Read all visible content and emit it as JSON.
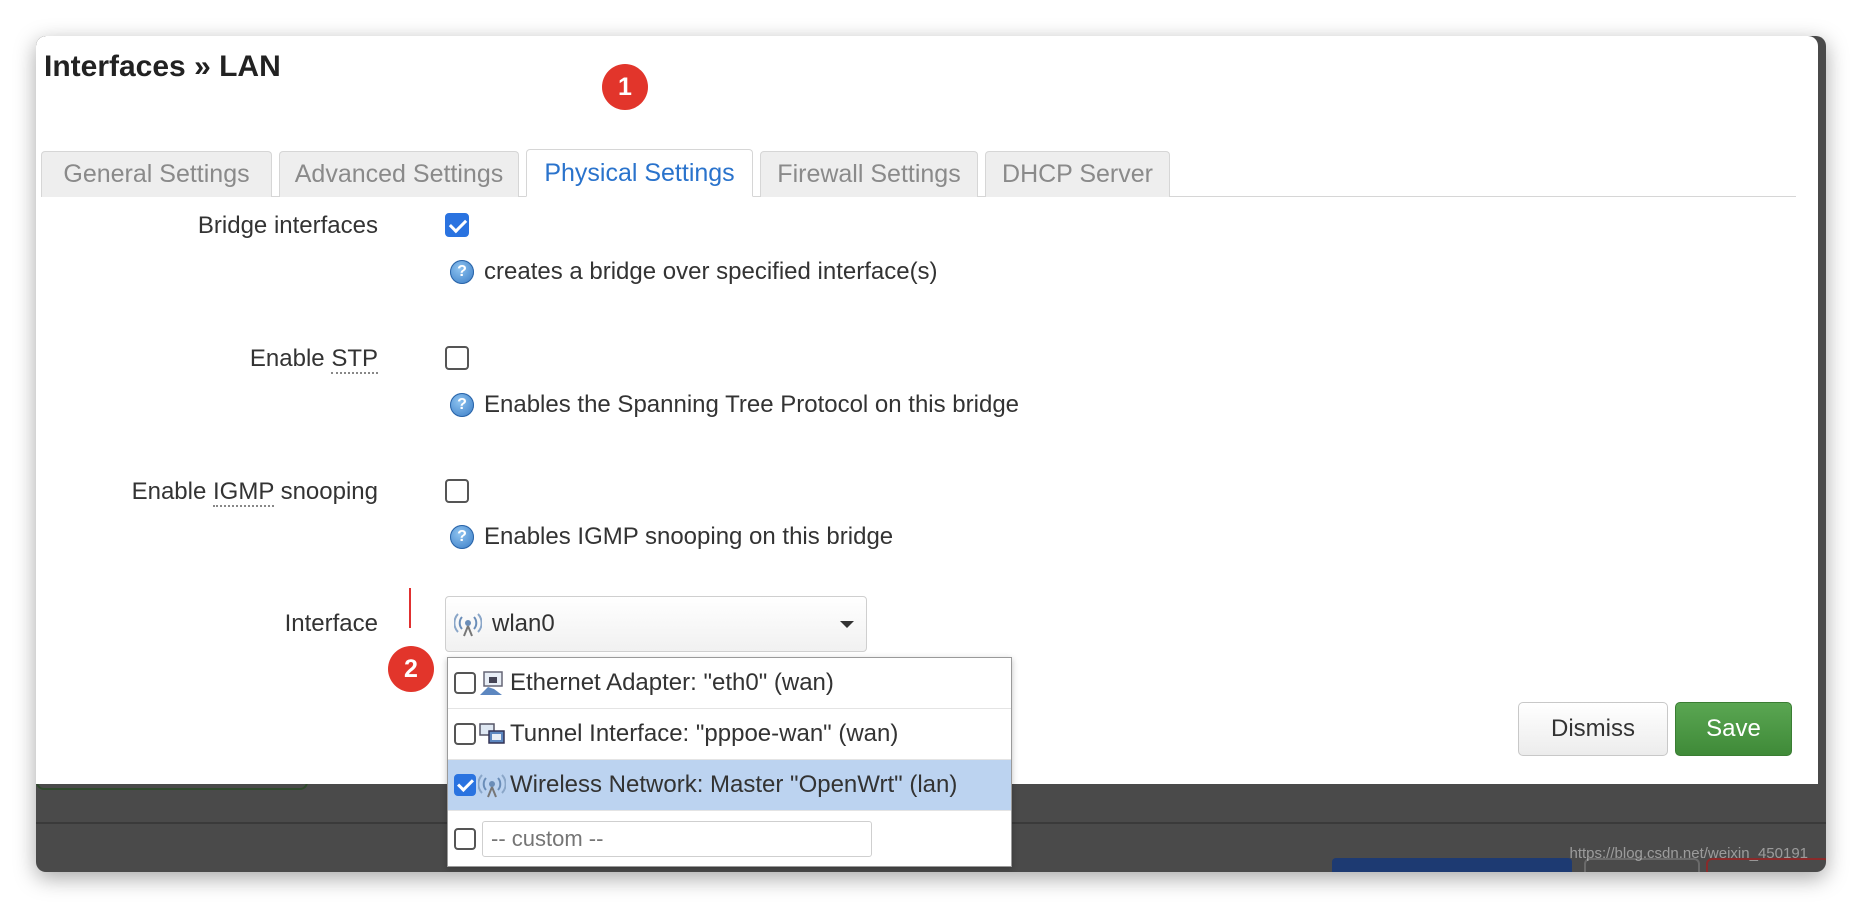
{
  "title": "Interfaces » LAN",
  "tabs": [
    {
      "label": "General Settings"
    },
    {
      "label": "Advanced Settings"
    },
    {
      "label": "Physical Settings"
    },
    {
      "label": "Firewall Settings"
    },
    {
      "label": "DHCP Server"
    }
  ],
  "active_tab": "Physical Settings",
  "badges": {
    "one": "1",
    "two": "2"
  },
  "fields": {
    "bridge": {
      "label": "Bridge interfaces",
      "checked": true,
      "help": "creates a bridge over specified interface(s)"
    },
    "stp": {
      "label_pre": "Enable ",
      "label_abbr": "STP",
      "checked": false,
      "help": "Enables the Spanning Tree Protocol on this bridge"
    },
    "igmp": {
      "label_pre": "Enable ",
      "label_abbr": "IGMP",
      "label_post": " snooping",
      "checked": false,
      "help": "Enables IGMP snooping on this bridge"
    },
    "interface": {
      "label": "Interface",
      "selected_value": "wlan0",
      "icon": "wireless-icon"
    }
  },
  "dropdown": {
    "options": [
      {
        "label": "Ethernet Adapter: \"eth0\" (wan)",
        "checked": false,
        "icon": "ethernet-icon"
      },
      {
        "label": "Tunnel Interface: \"pppoe-wan\" (wan)",
        "checked": false,
        "icon": "tunnel-icon"
      },
      {
        "label": "Wireless Network: Master \"OpenWrt\" (lan)",
        "checked": true,
        "icon": "wireless-icon"
      }
    ],
    "custom_placeholder": "-- custom --"
  },
  "buttons": {
    "dismiss": "Dismiss",
    "save": "Save"
  },
  "colors": {
    "accent": "#2a73cc",
    "save": "#4a9a43",
    "badge": "#e2352b",
    "selected_row": "#bcd3f0"
  },
  "watermark": "https://blog.csdn.net/weixin_450191"
}
